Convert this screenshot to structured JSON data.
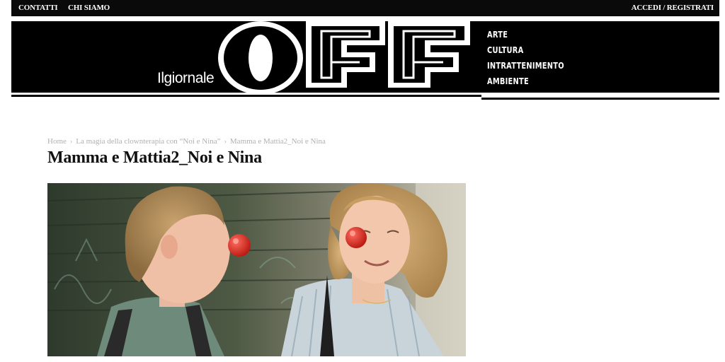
{
  "topbar": {
    "links": [
      "CONTATTI",
      "CHI SIAMO"
    ],
    "account": "ACCEDI / REGISTRATI"
  },
  "header": {
    "brand_small": "Ilgiornale",
    "logo_text": "OFF",
    "nav": [
      "ARTE",
      "CULTURA",
      "INTRATTENIMENTO",
      "AMBIENTE"
    ]
  },
  "breadcrumb": {
    "home": "Home",
    "parent": "La magia della clownterapia con “Noi e Nina”",
    "current": "Mamma e Mattia2_Noi e Nina"
  },
  "article": {
    "title": "Mamma e Mattia2_Noi e Nina"
  },
  "colors": {
    "topbar_bg": "#0a0a0a",
    "header_bg": "#000000",
    "breadcrumb": "#b0b0b0",
    "clown_nose": "#d42a25"
  },
  "photo": {
    "subject": "boy and woman with red clown noses"
  }
}
